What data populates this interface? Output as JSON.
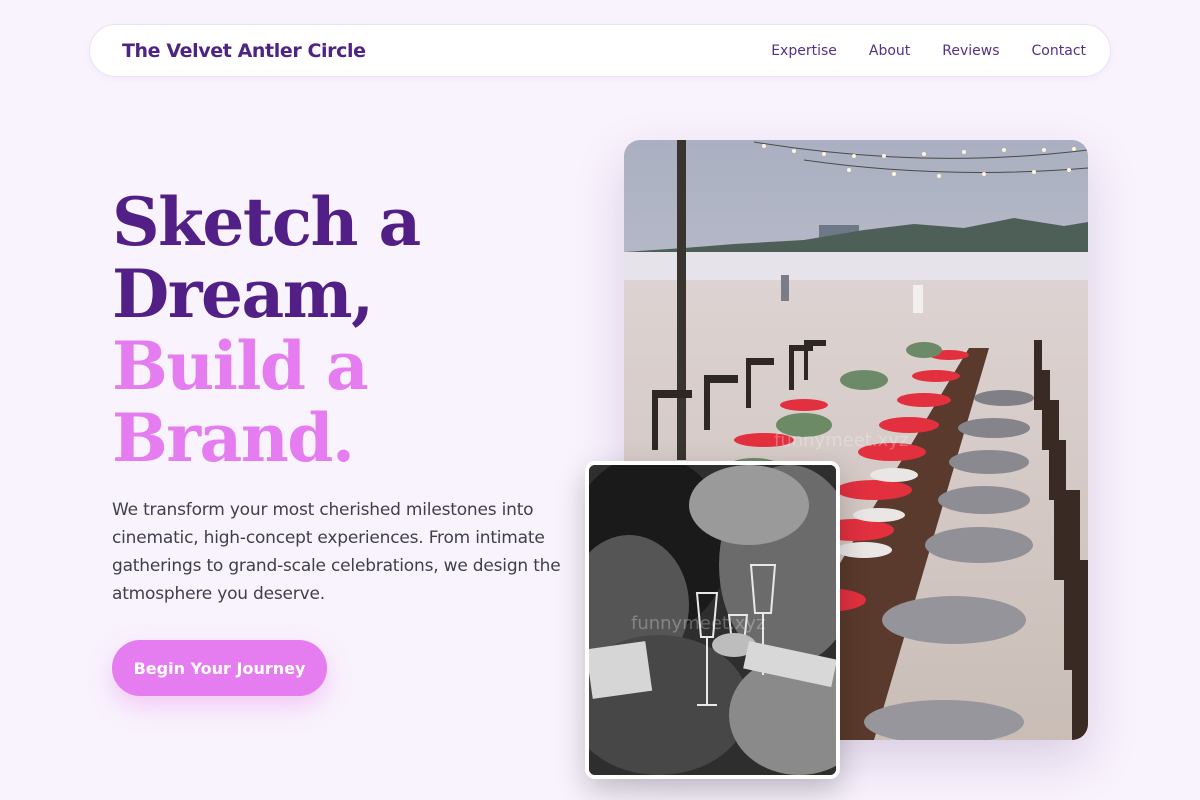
{
  "header": {
    "brand": "The Velvet Antler Circle",
    "nav": [
      {
        "label": "Expertise"
      },
      {
        "label": "About"
      },
      {
        "label": "Reviews"
      },
      {
        "label": "Contact"
      }
    ]
  },
  "hero": {
    "headline_line1": "Sketch a",
    "headline_line2": "Dream,",
    "headline_line3": "Build a",
    "headline_line4": "Brand.",
    "description": "We transform your most cherished milestones into cinematic, high-concept experiences. From intimate gatherings to grand-scale celebrations, we design the atmosphere you deserve.",
    "cta_label": "Begin Your Journey"
  },
  "images": {
    "main_watermark": "funnymeet.xyz",
    "inset_watermark": "funnymeet.xyz"
  },
  "colors": {
    "background": "#f9f3fd",
    "primary": "#511f86",
    "accent": "#e57cef"
  }
}
